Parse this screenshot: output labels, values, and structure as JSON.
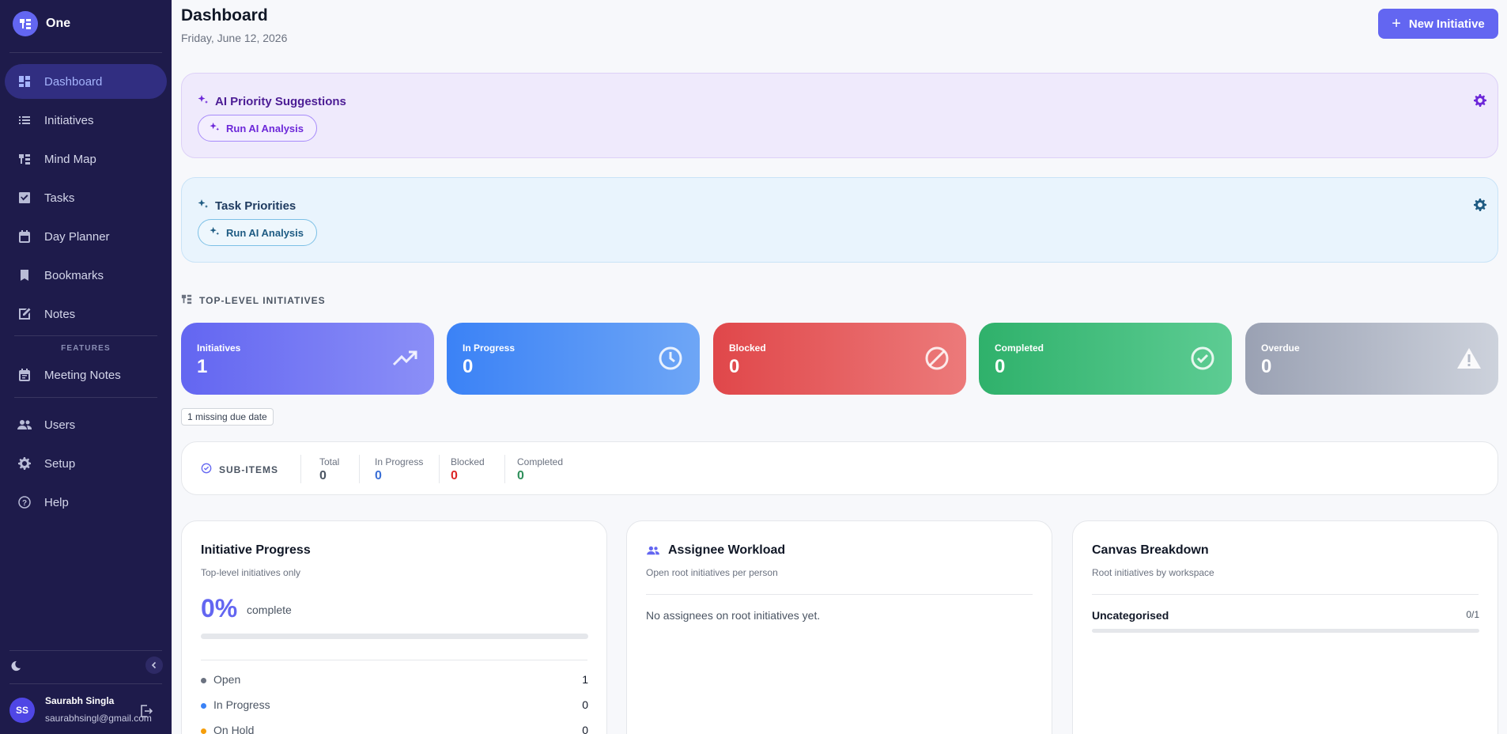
{
  "brand": {
    "name": "One"
  },
  "sidebar": {
    "items": [
      {
        "label": "Dashboard",
        "icon": "dashboard-icon"
      },
      {
        "label": "Initiatives",
        "icon": "list-icon"
      },
      {
        "label": "Mind Map",
        "icon": "mind-map-icon"
      },
      {
        "label": "Tasks",
        "icon": "checkbox-icon"
      },
      {
        "label": "Day Planner",
        "icon": "calendar-icon"
      },
      {
        "label": "Bookmarks",
        "icon": "bookmark-icon"
      },
      {
        "label": "Notes",
        "icon": "note-icon"
      }
    ],
    "features_label": "FEATURES",
    "features": [
      {
        "label": "Meeting Notes",
        "icon": "meeting-notes-icon"
      }
    ],
    "admin": [
      {
        "label": "Users",
        "icon": "users-icon"
      },
      {
        "label": "Setup",
        "icon": "gear-icon"
      },
      {
        "label": "Help",
        "icon": "help-icon"
      }
    ]
  },
  "user": {
    "initials": "SS",
    "name": "Saurabh Singla",
    "email": "saurabhsingl@gmail.com"
  },
  "header": {
    "title": "Dashboard",
    "date": "Friday, June 12, 2026",
    "new_button": "New Initiative"
  },
  "ai_cards": [
    {
      "title": "AI Priority Suggestions",
      "button": "Run AI Analysis"
    },
    {
      "title": "Task Priorities",
      "button": "Run AI Analysis"
    }
  ],
  "top_level": {
    "label": "TOP-LEVEL INITIATIVES",
    "stats": [
      {
        "label": "Initiatives",
        "value": "1",
        "icon": "trending-up-icon"
      },
      {
        "label": "In Progress",
        "value": "0",
        "icon": "clock-icon"
      },
      {
        "label": "Blocked",
        "value": "0",
        "icon": "blocked-icon"
      },
      {
        "label": "Completed",
        "value": "0",
        "icon": "check-circle-icon"
      },
      {
        "label": "Overdue",
        "value": "0",
        "icon": "warning-icon"
      }
    ],
    "missing_badge": "1 missing due date"
  },
  "sub_items": {
    "label": "SUB-ITEMS",
    "cols": [
      {
        "label": "Total",
        "value": "0",
        "color": "#4b5563"
      },
      {
        "label": "In Progress",
        "value": "0",
        "color": "#3b6fd6"
      },
      {
        "label": "Blocked",
        "value": "0",
        "color": "#dc2626"
      },
      {
        "label": "Completed",
        "value": "0",
        "color": "#2f8f5b"
      }
    ]
  },
  "progress_panel": {
    "title": "Initiative Progress",
    "subtitle": "Top-level initiatives only",
    "percent": "0%",
    "percent_label": "complete",
    "progress_fraction": 0,
    "statuses": [
      {
        "label": "Open",
        "count": "1",
        "color": "#6b7280"
      },
      {
        "label": "In Progress",
        "count": "0",
        "color": "#3b82f6"
      },
      {
        "label": "On Hold",
        "count": "0",
        "color": "#f59e0b"
      }
    ]
  },
  "workload_panel": {
    "title": "Assignee Workload",
    "subtitle": "Open root initiatives per person",
    "empty": "No assignees on root initiatives yet."
  },
  "canvas_panel": {
    "title": "Canvas Breakdown",
    "subtitle": "Root initiatives by workspace",
    "rows": [
      {
        "name": "Uncategorised",
        "fraction": "0/1"
      }
    ]
  },
  "colors": {
    "accent": "#6366f1",
    "sidebar": "#1e1b4b"
  }
}
